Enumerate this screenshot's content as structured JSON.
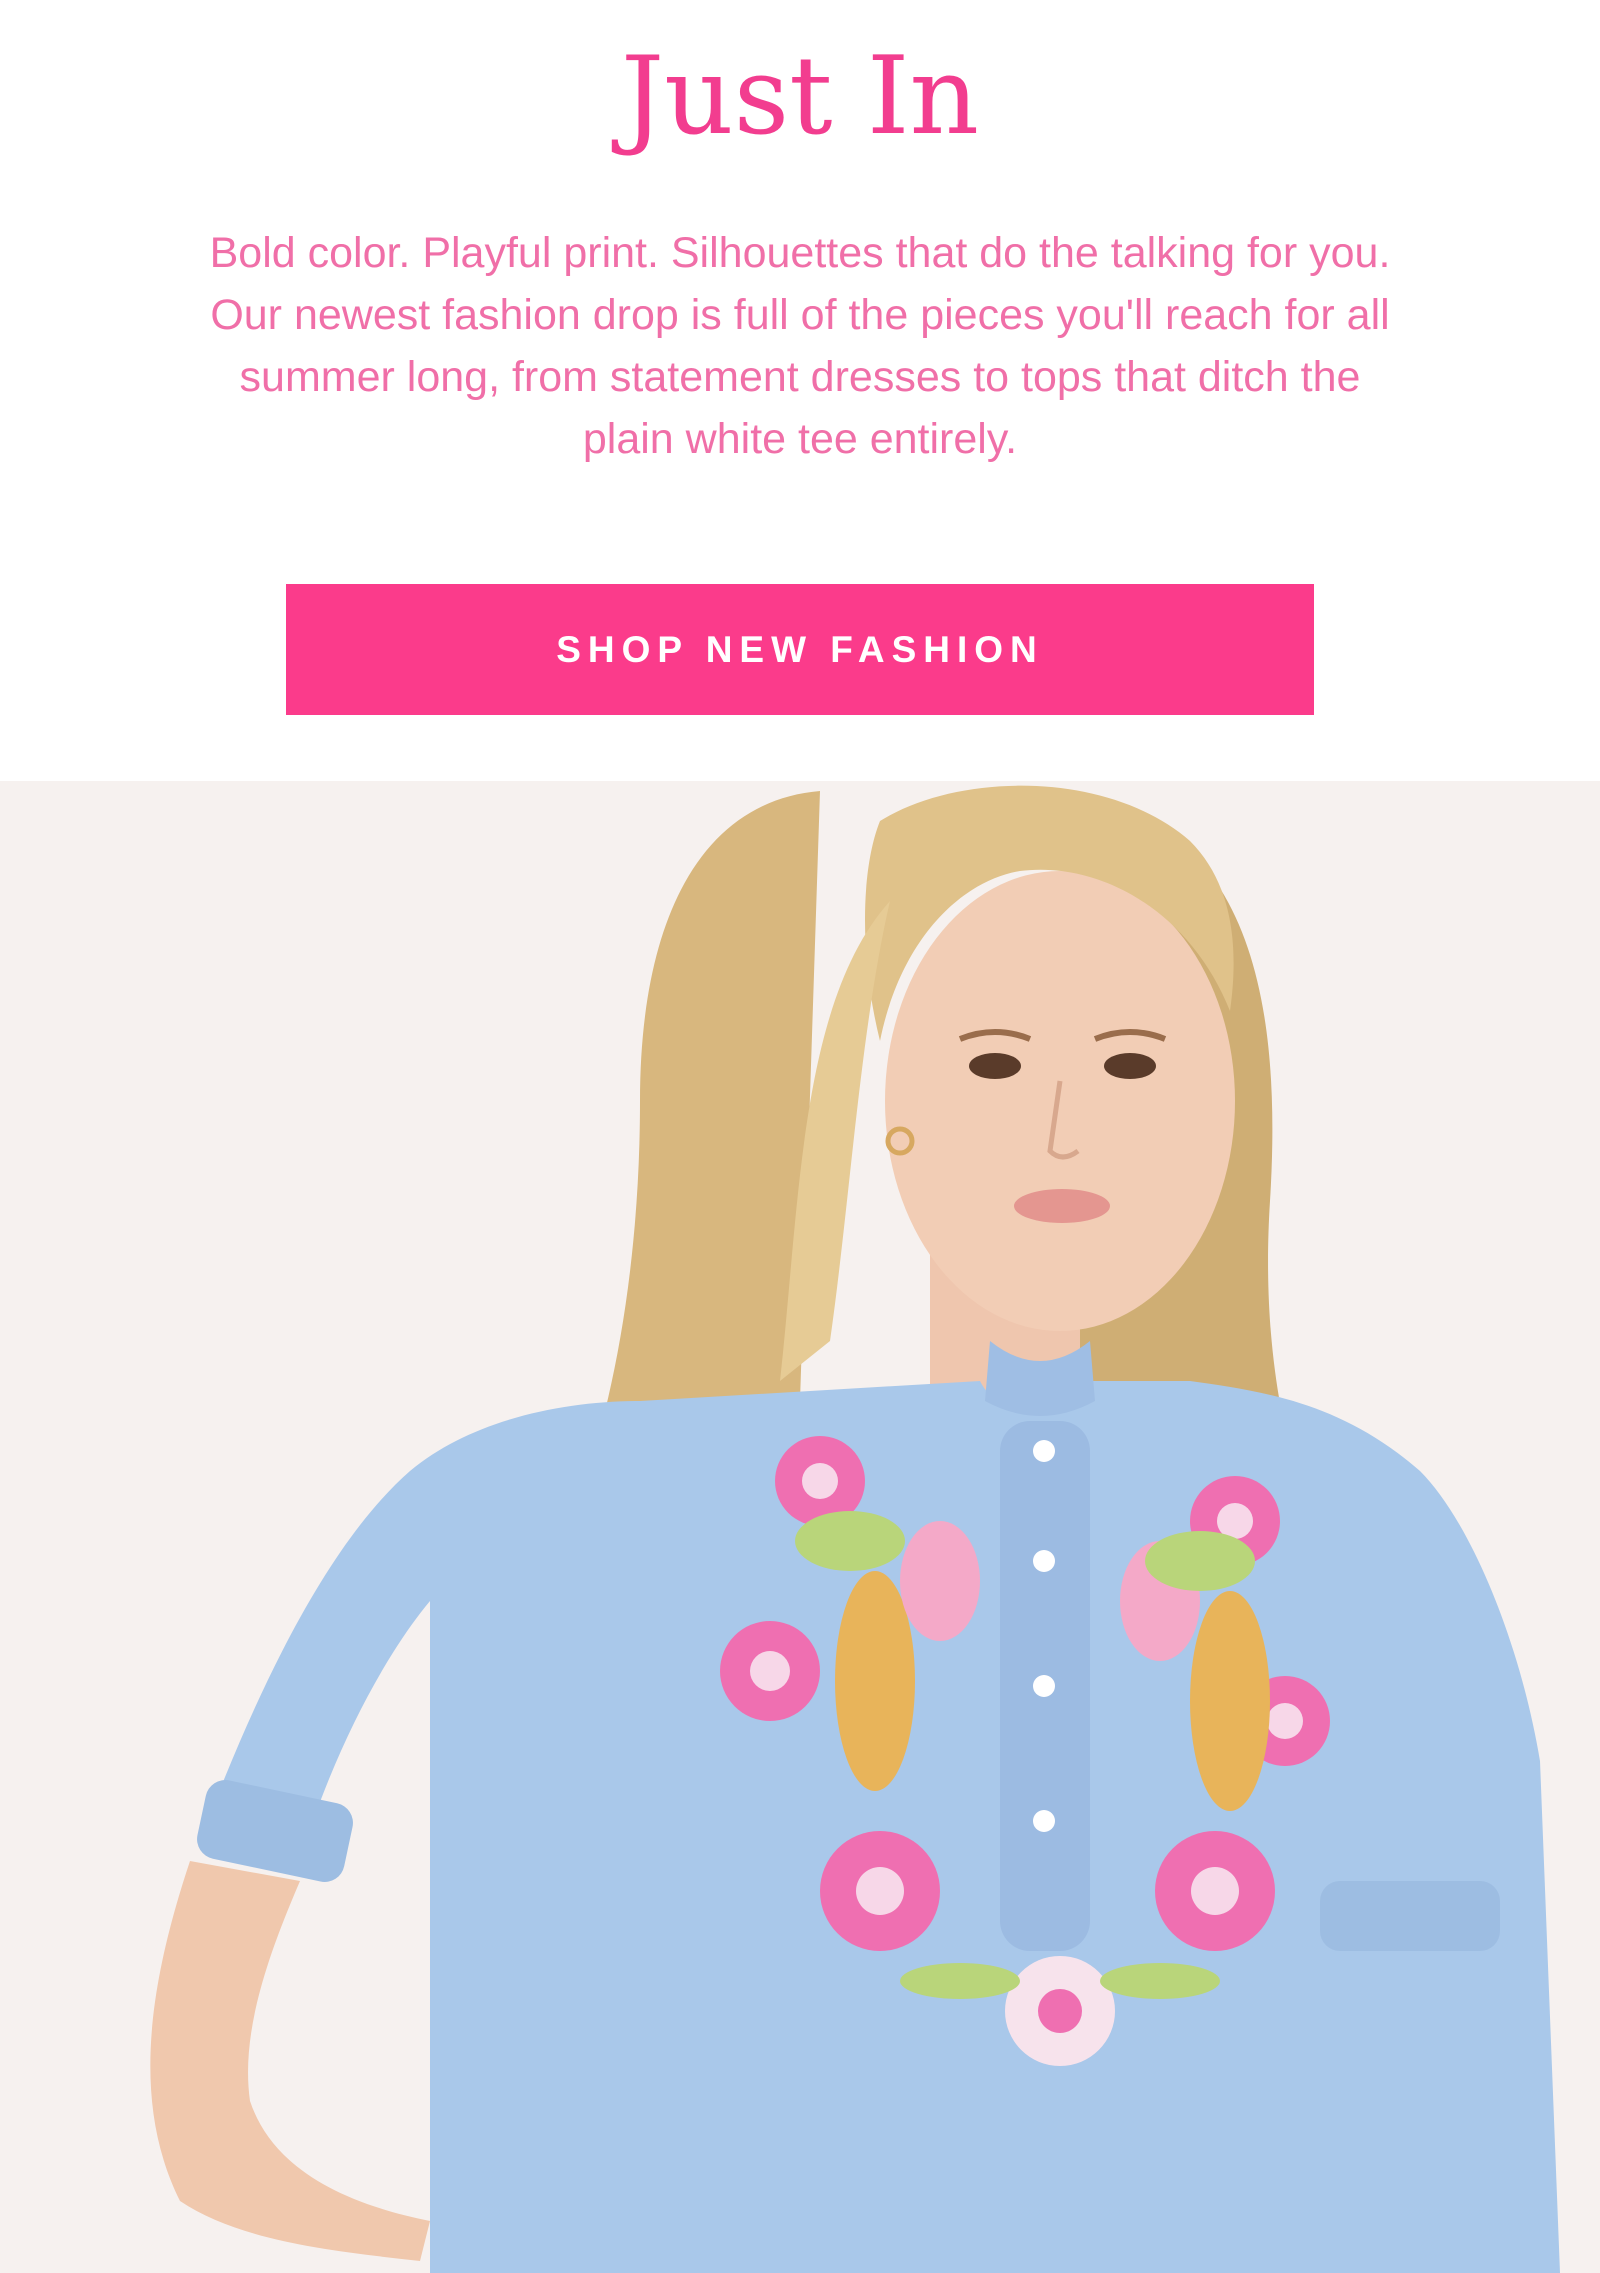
{
  "hero": {
    "title": "Just In",
    "description": "Bold color. Playful print. Silhouettes that do the talking for you. Our newest fashion drop is full of the pieces you'll reach for all summer long, from statement dresses to tops that ditch the plain white tee entirely.",
    "cta_label": "SHOP NEW FASHION"
  },
  "colors": {
    "accent": "#fb3b8b",
    "title": "#f23d8f",
    "body_text": "#f06fa8",
    "photo_bg": "#f6f1ef",
    "blouse": "#a9c8ea"
  },
  "photo": {
    "icon": "model-photo-icon"
  }
}
